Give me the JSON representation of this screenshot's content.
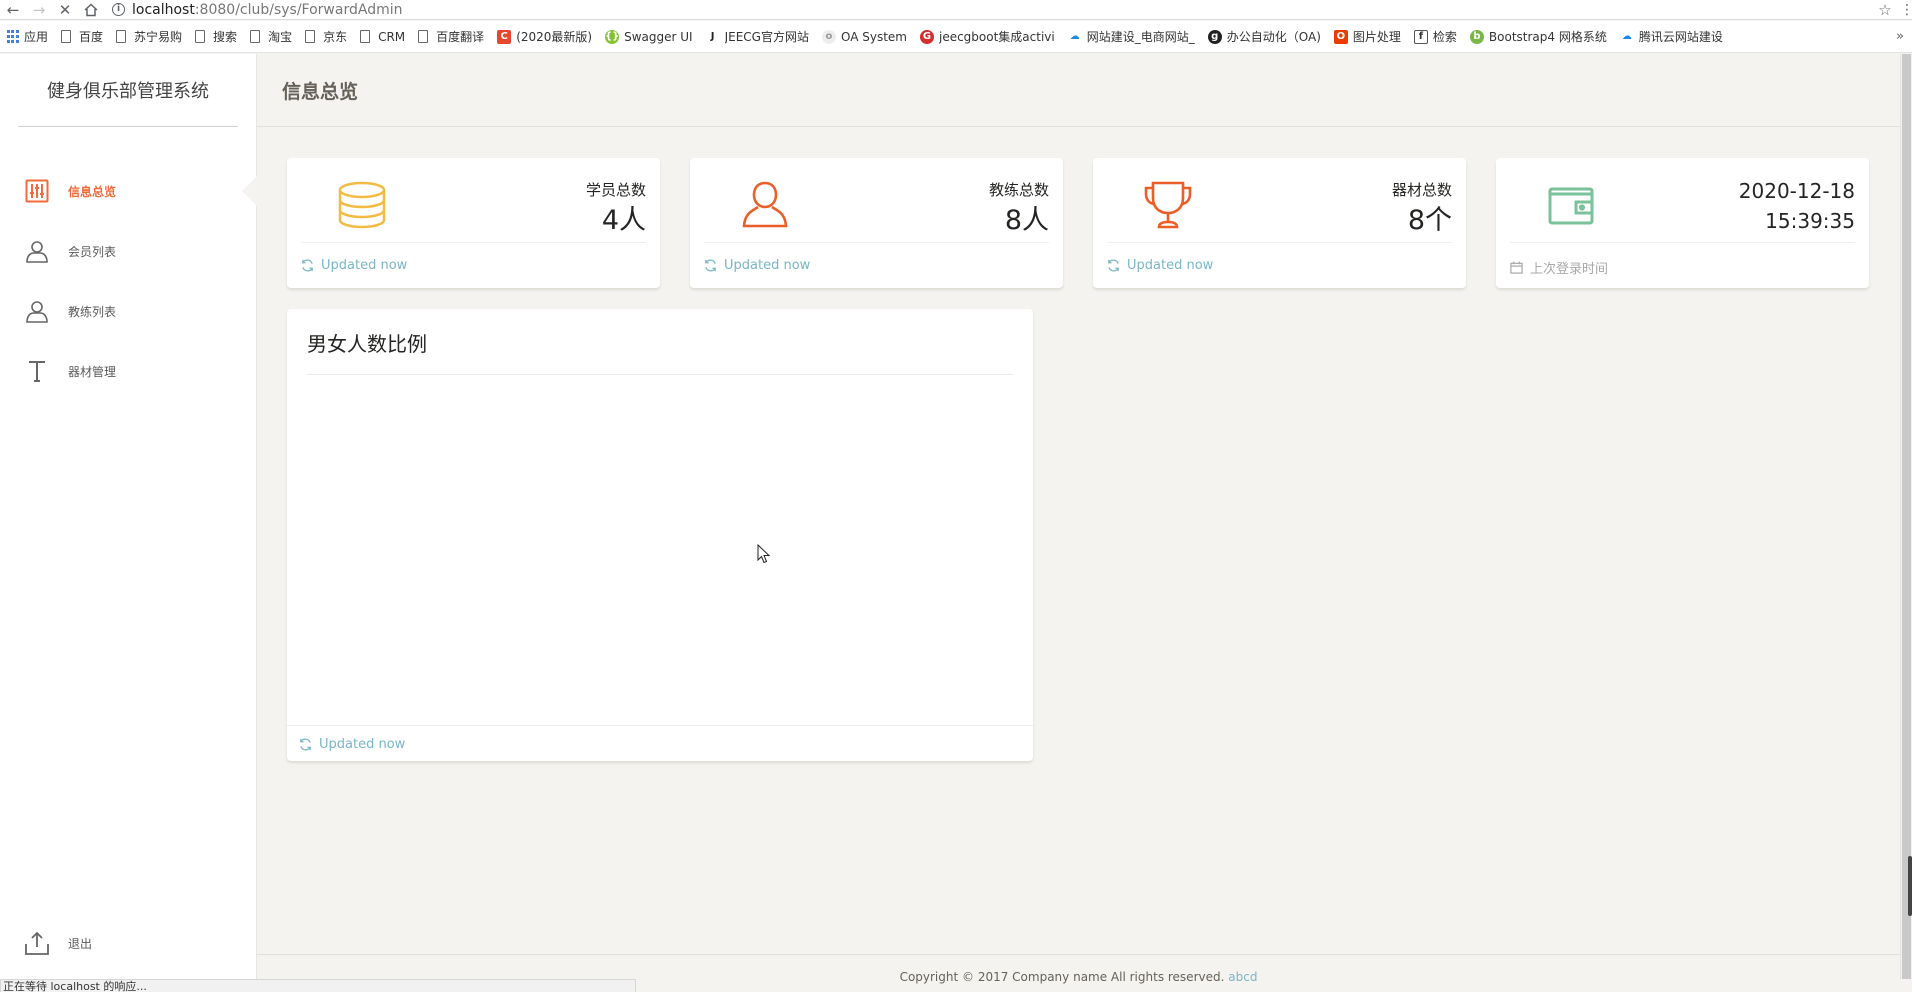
{
  "browser": {
    "url_host": "localhost",
    "url_path": ":8080/club/sys/ForwardAdmin",
    "bookmarks": [
      {
        "label": "应用",
        "icon": "apps-grid-icon"
      },
      {
        "label": "百度",
        "icon": "page-icon"
      },
      {
        "label": "苏宁易购",
        "icon": "page-icon"
      },
      {
        "label": "搜索",
        "icon": "page-icon"
      },
      {
        "label": "淘宝",
        "icon": "page-icon"
      },
      {
        "label": "京东",
        "icon": "page-icon"
      },
      {
        "label": "CRM",
        "icon": "page-icon"
      },
      {
        "label": "百度翻译",
        "icon": "page-icon"
      },
      {
        "label": "(2020最新版)",
        "icon": "c-logo-icon"
      },
      {
        "label": "Swagger UI",
        "icon": "swagger-icon"
      },
      {
        "label": "JEECG官方网站",
        "icon": "j-logo-icon"
      },
      {
        "label": "OA System",
        "icon": "oa-icon"
      },
      {
        "label": "jeecgboot集成activi",
        "icon": "g-logo-icon"
      },
      {
        "label": "网站建设_电商网站_",
        "icon": "cloud-icon"
      },
      {
        "label": "办公自动化（OA)",
        "icon": "github-icon"
      },
      {
        "label": "图片处理",
        "icon": "office-icon"
      },
      {
        "label": "检索",
        "icon": "search-logo-icon"
      },
      {
        "label": "Bootstrap4 网格系统",
        "icon": "bootstrap-icon"
      },
      {
        "label": "腾讯云网站建设",
        "icon": "tencent-cloud-icon"
      }
    ],
    "more": "»",
    "status_text": "正在等待 localhost 的响应..."
  },
  "sidebar": {
    "brand": "健身俱乐部管理系统",
    "items": [
      {
        "label": "信息总览",
        "icon": "sliders-icon",
        "active": true
      },
      {
        "label": "会员列表",
        "icon": "user-icon",
        "active": false
      },
      {
        "label": "教练列表",
        "icon": "user-icon",
        "active": false
      },
      {
        "label": "器材管理",
        "icon": "text-t-icon",
        "active": false
      }
    ],
    "logout": {
      "label": "退出",
      "icon": "upload-icon"
    }
  },
  "header": {
    "title": "信息总览"
  },
  "stats": [
    {
      "label": "学员总数",
      "value": "4人",
      "footer": "Updated now",
      "icon": "coins-icon",
      "color": "#f3bb45"
    },
    {
      "label": "教练总数",
      "value": "8人",
      "footer": "Updated now",
      "icon": "user-icon",
      "color": "#eb5e28"
    },
    {
      "label": "器材总数",
      "value": "8个",
      "footer": "Updated now",
      "icon": "trophy-icon",
      "color": "#eb5e28"
    },
    {
      "date": "2020-12-18",
      "time": "15:39:35",
      "footer": "上次登录时间",
      "icon": "wallet-icon",
      "color": "#7ac29a"
    }
  ],
  "chart": {
    "title": "男女人数比例",
    "footer": "Updated now"
  },
  "footer": {
    "text": "Copyright © 2017 Company name All rights reserved.",
    "link": "abcd"
  },
  "colors": {
    "accent": "#f26b3a",
    "info": "#7ab6c7",
    "warning": "#f3bb45",
    "success": "#7ac29a",
    "background": "#f4f3ef"
  }
}
